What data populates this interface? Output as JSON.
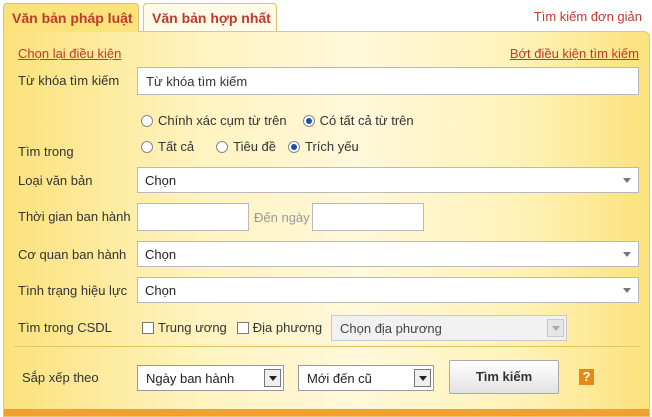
{
  "tabs": {
    "legal_docs": "Văn bản pháp luật",
    "consolidated_docs": "Văn bản hợp nhất"
  },
  "simple_search": "Tìm kiếm đơn giản",
  "links": {
    "reset_conditions": "Chọn lại điều kiện",
    "fewer_conditions": "Bớt điều kiện tìm kiếm"
  },
  "keyword": {
    "label": "Từ khóa tìm kiếm",
    "placeholder": "Từ khóa tìm kiếm"
  },
  "match": {
    "exact": "Chính xác cụm từ trên",
    "all_words": "Có tất cả từ trên",
    "selected": "all_words"
  },
  "search_in": {
    "label": "Tìm trong",
    "all": "Tất cả",
    "title": "Tiêu đề",
    "summary": "Trích yếu",
    "selected": "summary"
  },
  "doc_type": {
    "label": "Loại văn bản",
    "value": "Chọn"
  },
  "issue_date": {
    "label": "Thời gian ban hành",
    "to_placeholder": "Đến ngày"
  },
  "issuing_agency": {
    "label": "Cơ quan ban hành",
    "value": "Chọn"
  },
  "status": {
    "label": "Tình trạng hiệu lực",
    "value": "Chọn"
  },
  "database": {
    "label": "Tìm trong CSDL",
    "central": "Trung ương",
    "local": "Địa phương",
    "local_select": "Chọn địa phương"
  },
  "sort": {
    "label": "Sắp xếp theo",
    "field": "Ngày ban hành",
    "order": "Mới đến cũ"
  },
  "search_button": "Tìm kiếm",
  "help": "?"
}
